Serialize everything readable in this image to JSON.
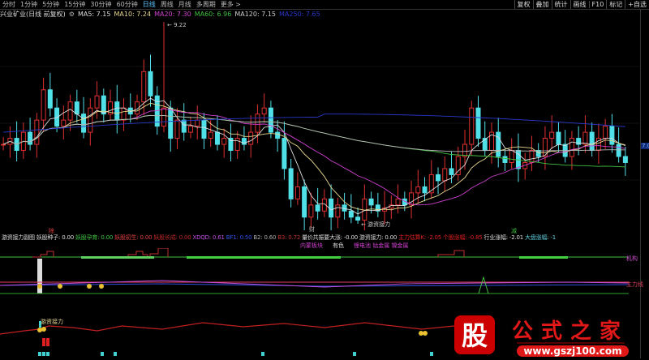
{
  "periods": [
    "分时",
    "1分钟",
    "5分钟",
    "15分钟",
    "30分钟",
    "60分钟",
    "日线",
    "周线",
    "月线",
    "多周期",
    "更多 >"
  ],
  "active_period": "日线",
  "tools": [
    "复权",
    "叠加",
    "统计",
    "画线",
    "F10",
    "标记",
    "+自选"
  ],
  "info": {
    "title": "兴业矿业(日线 前复权)",
    "ma5": "MA5: 7.15",
    "ma10": "MA10: 7.24",
    "ma20": "MA20: 7.30",
    "ma60": "MA60: 6.96",
    "ma120": "MA120: 7.15",
    "ma250": "MA250: 7.65"
  },
  "high_label": "9.22",
  "low_label": "游资接力",
  "price_tag": "7.0",
  "markers": {
    "m1": "除",
    "m2": "财",
    "m3": "减"
  },
  "sub1": [
    {
      "t": "游资接力副图",
      "c": "#ddd"
    },
    {
      "t": "妖股种子: 0.00",
      "c": "#ddd"
    },
    {
      "t": "妖股孕育: 0.00",
      "c": "#3ec43e"
    },
    {
      "t": "妖股初生: 0.00",
      "c": "#e04040"
    },
    {
      "t": "妖股长成: 0.00",
      "c": "#c02828"
    },
    {
      "t": "XDQD: 0.61",
      "c": "#c050e0"
    },
    {
      "t": "BF1: 0.50",
      "c": "#3050e0"
    },
    {
      "t": "B2: 0.60",
      "c": "#aaa"
    },
    {
      "t": "B3: 0.72",
      "c": "#c03030"
    },
    {
      "t": "量价共振要大涨: -0.00",
      "c": "#ddd"
    },
    {
      "t": "游资接力: 0.00",
      "c": "#ddd"
    },
    {
      "t": "主力估算K: -2.05",
      "c": "#e02020"
    },
    {
      "t": "个股涨幅: -0.85",
      "c": "#e02020"
    },
    {
      "t": "行业涨幅: -2.01",
      "c": "#ddd"
    },
    {
      "t": "大盘涨幅: -1",
      "c": "#60d0e0"
    }
  ],
  "sub2": [
    {
      "t": "内蒙板块",
      "c": "#d040d0"
    },
    {
      "t": "有色",
      "c": "#ddd"
    },
    {
      "t": "锂电池 钴金属 镍金属",
      "c": "#d040d0"
    }
  ],
  "right_labels": {
    "jigou": "机构",
    "zhuli": "主力线"
  },
  "logo": {
    "brand": "股",
    "name": "公式之家",
    "url": "www.gszj100.com"
  },
  "chart_data": {
    "type": "candlestick",
    "high": 9.22,
    "low": 5.89,
    "closes": [
      7.2,
      7.3,
      7.1,
      7.4,
      7.2,
      7.6,
      8.1,
      7.8,
      7.5,
      7.6,
      7.9,
      7.7,
      7.4,
      7.8,
      8.0,
      7.7,
      7.9,
      7.6,
      7.8,
      7.7,
      7.9,
      8.4,
      8.0,
      7.5,
      7.8,
      7.3,
      7.6,
      7.4,
      7.5,
      7.6,
      7.3,
      7.4,
      7.2,
      7.3,
      7.1,
      7.3,
      7.2,
      7.4,
      7.7,
      7.8,
      7.4,
      7.3,
      6.8,
      6.3,
      6.5,
      6.0,
      6.2,
      6.1,
      6.3,
      6.0,
      6.2,
      6.1,
      6.0,
      5.95,
      6.3,
      6.2,
      6.1,
      6.15,
      6.2,
      6.3,
      6.2,
      6.4,
      6.5,
      6.4,
      6.7,
      6.6,
      6.8,
      6.7,
      7.0,
      7.2,
      7.8,
      7.3,
      7.1,
      7.4,
      7.0,
      6.9,
      7.1,
      6.8,
      6.9,
      7.1,
      7.0,
      7.3,
      7.4,
      7.2,
      7.0,
      7.3,
      7.2,
      7.4,
      7.1,
      7.3,
      7.5,
      7.2,
      7.0,
      6.9
    ]
  }
}
